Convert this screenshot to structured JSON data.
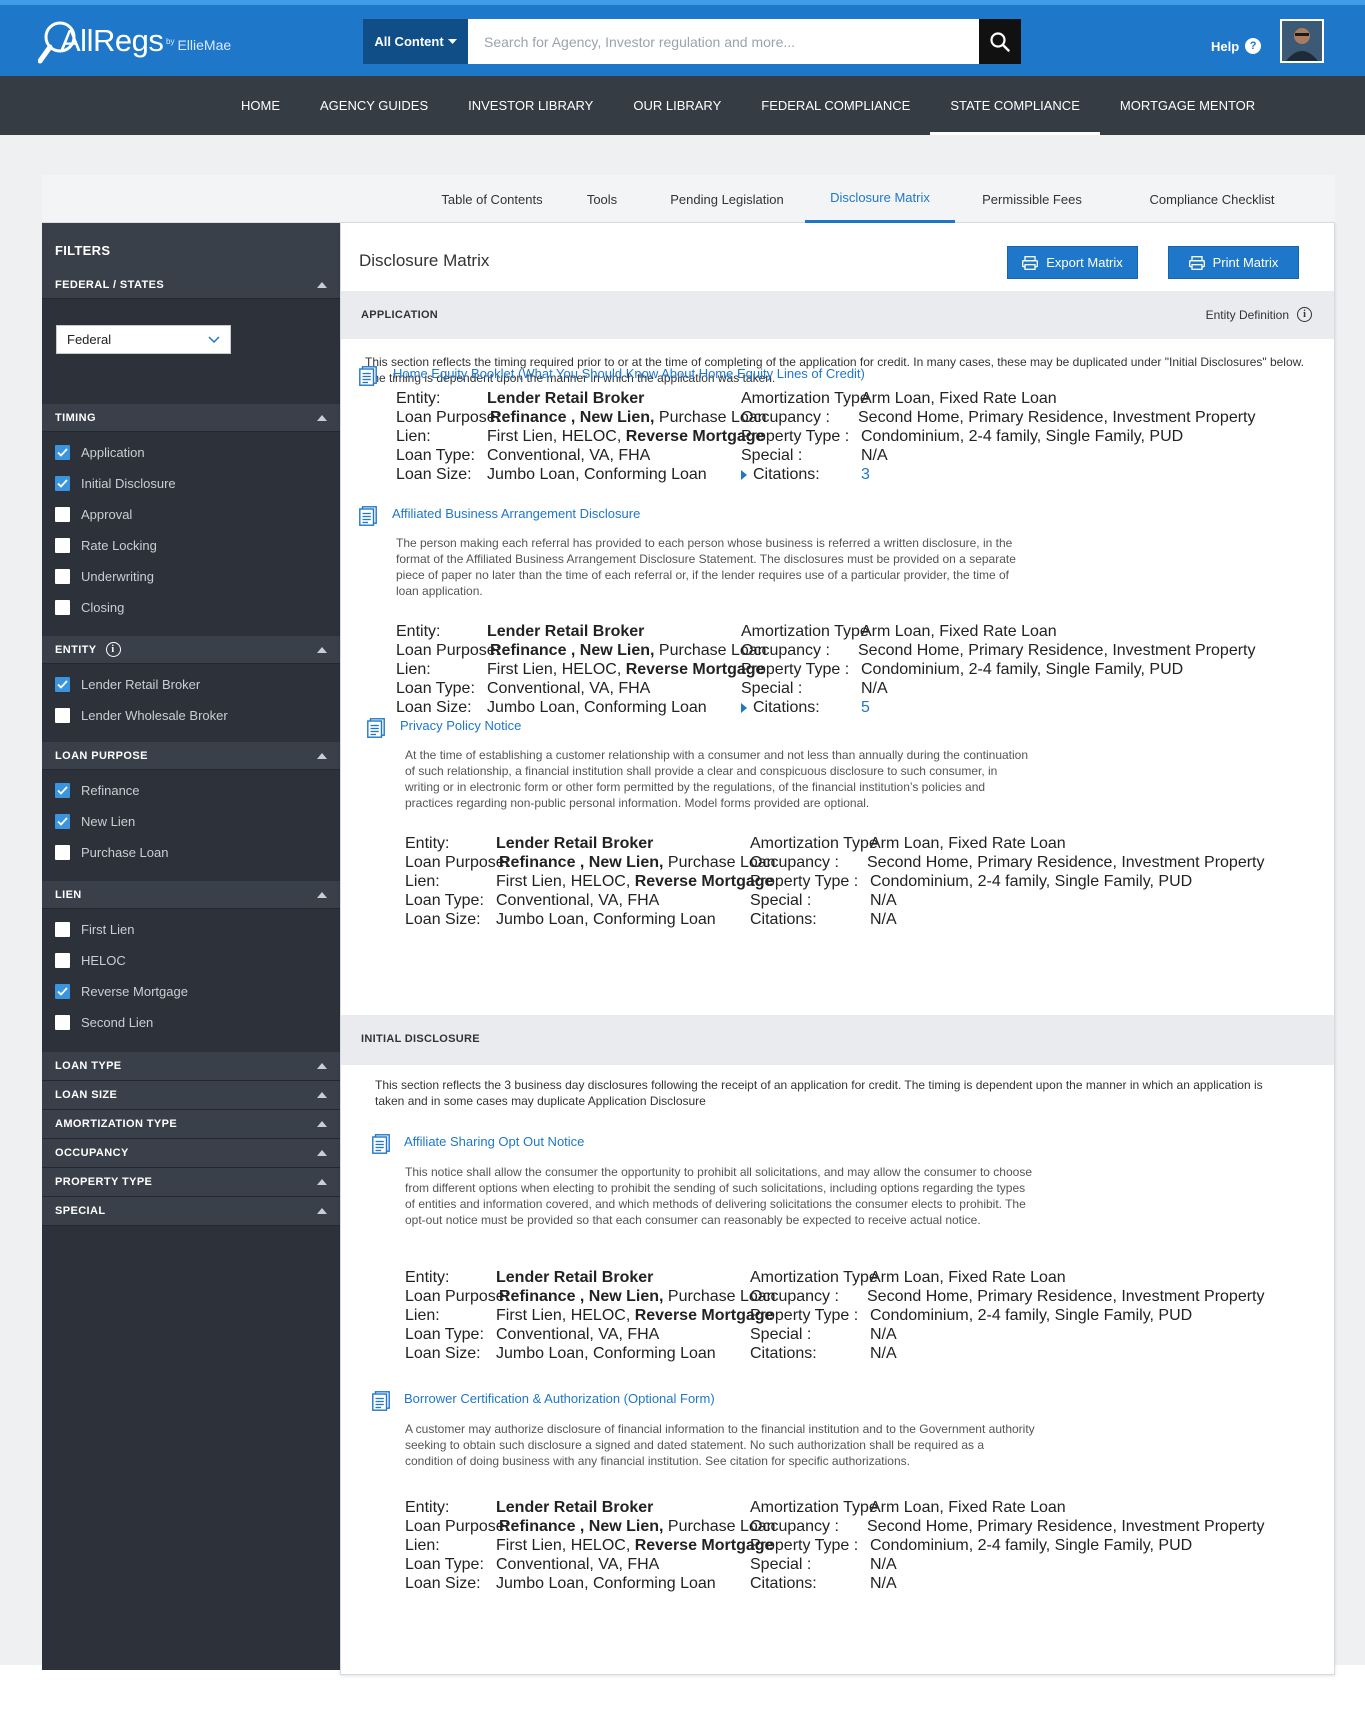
{
  "header": {
    "logo_main": "AllRegs",
    "logo_by": "by",
    "logo_brand": "EllieMae",
    "scope_label": "All Content",
    "search_placeholder": "Search for Agency, Investor regulation and more...",
    "help_label": "Help"
  },
  "nav": {
    "items": [
      "HOME",
      "AGENCY GUIDES",
      "INVESTOR LIBRARY",
      "OUR LIBRARY",
      "FEDERAL COMPLIANCE",
      "STATE COMPLIANCE",
      "MORTGAGE MENTOR"
    ],
    "active": "STATE COMPLIANCE"
  },
  "subtabs": {
    "items": [
      "Table of Contents",
      "Tools",
      "Pending Legislation",
      "Disclosure Matrix",
      "Permissible Fees",
      "Compliance Checklist"
    ],
    "active": "Disclosure Matrix"
  },
  "sidebar": {
    "title": "FILTERS",
    "federal_states": {
      "label": "FEDERAL / STATES",
      "selected": "Federal"
    },
    "timing": {
      "label": "TIMING",
      "items": [
        {
          "label": "Application",
          "checked": true
        },
        {
          "label": "Initial Disclosure",
          "checked": true
        },
        {
          "label": "Approval",
          "checked": false
        },
        {
          "label": "Rate Locking",
          "checked": false
        },
        {
          "label": "Underwriting",
          "checked": false
        },
        {
          "label": "Closing",
          "checked": false
        }
      ]
    },
    "entity": {
      "label": "ENTITY",
      "items": [
        {
          "label": "Lender Retail Broker",
          "checked": true
        },
        {
          "label": "Lender Wholesale Broker",
          "checked": false
        }
      ]
    },
    "loan_purpose": {
      "label": "LOAN PURPOSE",
      "items": [
        {
          "label": "Refinance",
          "checked": true
        },
        {
          "label": "New Lien",
          "checked": true
        },
        {
          "label": "Purchase Loan",
          "checked": false
        }
      ]
    },
    "lien": {
      "label": "LIEN",
      "items": [
        {
          "label": "First Lien",
          "checked": false
        },
        {
          "label": "HELOC",
          "checked": false
        },
        {
          "label": "Reverse Mortgage",
          "checked": true
        },
        {
          "label": "Second Lien",
          "checked": false
        }
      ]
    },
    "collapsed_sections": [
      "LOAN TYPE",
      "LOAN SIZE",
      "AMORTIZATION TYPE",
      "OCCUPANCY",
      "PROPERTY  TYPE",
      "SPECIAL"
    ]
  },
  "main": {
    "title": "Disclosure Matrix",
    "export_label": "Export Matrix",
    "print_label": "Print Matrix",
    "entity_definition_label": "Entity Definition",
    "labels": {
      "entity": "Entity:",
      "loan_purpose": "Loan Purpose:",
      "lien": "Lien:",
      "loan_type": "Loan Type:",
      "loan_size": "Loan Size:",
      "amortization": "Amortization Type",
      "occupancy": "Occupancy :",
      "property_type": "Property Type :",
      "special": "Special :",
      "citations": "Citations:"
    },
    "values": {
      "entity": "Lender Retail Broker",
      "lp_bold": "Refinance , New Lien,",
      "lp_rest": " Purchase Loan",
      "lien_rest": "First Lien, HELOC, ",
      "lien_bold": "Reverse Mortgage",
      "loan_type": "Conventional, VA, FHA",
      "loan_size": "Jumbo Loan, Conforming Loan",
      "amortization": "Arm Loan, Fixed Rate Loan",
      "occupancy": "Second Home, Primary Residence, Investment Property",
      "property_type": "Condominium, 2-4 family, Single Family, PUD",
      "special": "N/A"
    },
    "sections": [
      {
        "label": "APPLICATION",
        "description": "This section reflects the timing required prior to or at the time of completing of the application for credit. In many cases, these may be duplicated under \"Initial Disclosures\" below. The timing is dependent upon the manner in which the application was taken.",
        "docs": [
          {
            "title": "Home Equity Booklet   (What You Should Know About Home Equity Lines of Credit)",
            "description": "",
            "citations": "3"
          },
          {
            "title": "Affiliated Business Arrangement Disclosure",
            "description": "The person making each referral has provided to each person whose business is referred a written disclosure, in the format of the Affiliated Business Arrangement Disclosure Statement. The disclosures must be provided on a separate piece of paper no later than the time of each referral or, if the lender requires use of a particular provider, the time of loan application.",
            "citations": "5"
          },
          {
            "title": "Privacy Policy Notice",
            "description": "At the time of establishing a customer relationship with a consumer and not less than annually during the continuation of such relationship, a financial institution shall provide a clear and conspicuous disclosure to such consumer, in writing or in electronic form or other form permitted by the regulations, of the financial institution’s policies and practices regarding non-public personal information. Model forms provided are optional.",
            "citations": "N/A"
          }
        ]
      },
      {
        "label": "INITIAL DISCLOSURE",
        "description": "This section reflects the 3 business day disclosures following the receipt of an application for credit. The timing is dependent upon the manner in which an application is taken and in some cases may duplicate Application Disclosure",
        "docs": [
          {
            "title": "Affiliate Sharing Opt Out Notice",
            "description": "This notice shall allow the consumer the opportunity to prohibit all solicitations, and may allow the consumer to choose from different options when electing to prohibit the sending of such solicitations, including options regarding the types of entities and information covered, and which methods of delivering solicitations the consumer elects to prohibit. The opt-out notice must be provided so that each consumer can reasonably be expected to receive actual notice.",
            "citations": "N/A"
          },
          {
            "title": "Borrower Certification & Authorization (Optional Form)",
            "description": "A customer may authorize disclosure of financial information to the financial institution and to the Government authority seeking to obtain such disclosure a signed and dated statement. No such authorization shall be required as a condition of doing business with any financial institution. See citation for specific authorizations.",
            "citations": "N/A"
          }
        ]
      }
    ]
  }
}
